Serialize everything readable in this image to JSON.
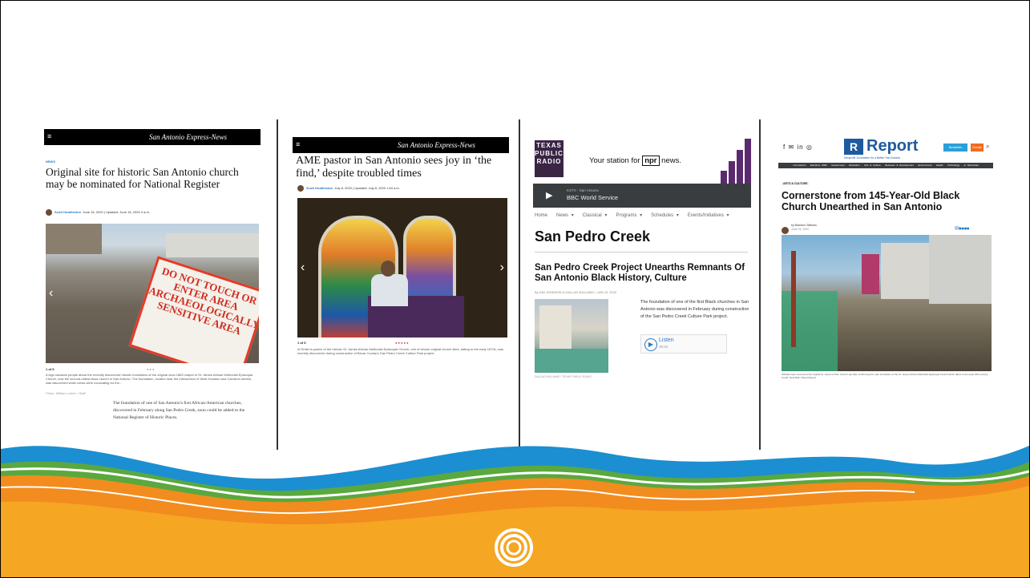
{
  "panel1": {
    "brand": "San Antonio Express-News",
    "menu_icon": "≡",
    "section": "NEWS",
    "headline": "Original site for historic San Antonio church may be nominated for National Register",
    "author": "Scott Huddleston",
    "dates": "June 15, 2020  |  Updated: June 15, 2020 4 a.m.",
    "counter": "1 of 5",
    "caption": "A sign cautions people about the recently discovered historic foundation of the original circa 1883 chapel of St. James African Methodist Episcopal Church, now the second-oldest black church in San Antonio. The foundation, located near the intersection of West Houston and Camaron streets, was discovered while crews were excavating for the...",
    "photo_credit": "Photo: William Luther / Staff",
    "body": "The foundation of one of San Antonio's first African-American churches, discovered in February along San Pedro Creek, soon could be added to the National Register of Historic Places.",
    "sign_text": "DO NOT TOUCH OR ENTER AREA ARCHAEOLOGICALLY SENSITIVE AREA"
  },
  "panel2": {
    "brand": "San Antonio Express-News",
    "menu_icon": "≡",
    "headline": "AME pastor in San Antonio sees joy in ‘the find,’ despite troubled times",
    "author": "Scott Huddleston",
    "dates": "July 8, 2020  |  Updated: July 8, 2020 1:54 a.m.",
    "counter": "1 of 5",
    "caption": "Al Smith is pastor of the historic St. James African Methodist Episcopal Church, one of whose original church sites, dating to the early 1870s, was recently discovered during construction of Bexar County's San Pedro Creek Culture Park project."
  },
  "panel3": {
    "logo_lines": [
      "TEXAS",
      "PUBLIC",
      "RADIO"
    ],
    "tagline_prefix": "Your station for",
    "tagline_npr": "npr",
    "tagline_suffix": "news.",
    "player_station": "KSTX - San Antonio",
    "player_program": "BBC World Service",
    "nav": [
      "Home",
      "News ▾",
      "Classical ▾",
      "Programs ▾",
      "Schedules ▾",
      "Events/Initiatives ▾"
    ],
    "topic": "San Pedro Creek",
    "headline": "San Pedro Creek Project Unearths Remnants Of San Antonio Black History, Culture",
    "byline": "By KIM JOHNSON & DALLAS WILLIAMS  •  JUN 23, 2020",
    "summary": "The foundation of one of the first Black churches in San Antonio was discovered in February during construction of the San Pedro Creek Culture Park project.",
    "listen_label": "Listen",
    "listen_time": "39:42",
    "photo_credit": "DALLAS WILLIAMS / TEXAS PUBLIC RADIO"
  },
  "panel4": {
    "social_icons": "f ✉ in ◎",
    "brand": "Report",
    "tagline": "Nonprofit Journalism for a Better San Antonio",
    "newsletter": "Newsletter",
    "donate": "Donate",
    "nav": [
      "Coronavirus",
      "Elections 2020",
      "Government",
      "Education",
      "Arts & Culture",
      "Business & Development",
      "Environment",
      "Health",
      "Technology",
      "In Memoriam"
    ],
    "tag": "ARTS & CULTURE",
    "headline": "Cornerstone from 145-Year-Old Black Church Unearthed in San Antonio",
    "author": "by Brandon Gibbons",
    "date": "June 25, 2020",
    "caption": "Officials have uncovered the original St. James A.M.E. Church site after confirming the main foundation of the St. James African Methodist Episcopal Church which dates to the early 19th century. Credit: Scott Ball / Rivard Report"
  },
  "colors": {
    "orange": "#f5a623",
    "blue": "#1b8fd1",
    "green": "#5aa83e",
    "nav_dark": "#3a3d40",
    "report_blue": "#1e5aa0",
    "report_orange": "#f26b21"
  }
}
